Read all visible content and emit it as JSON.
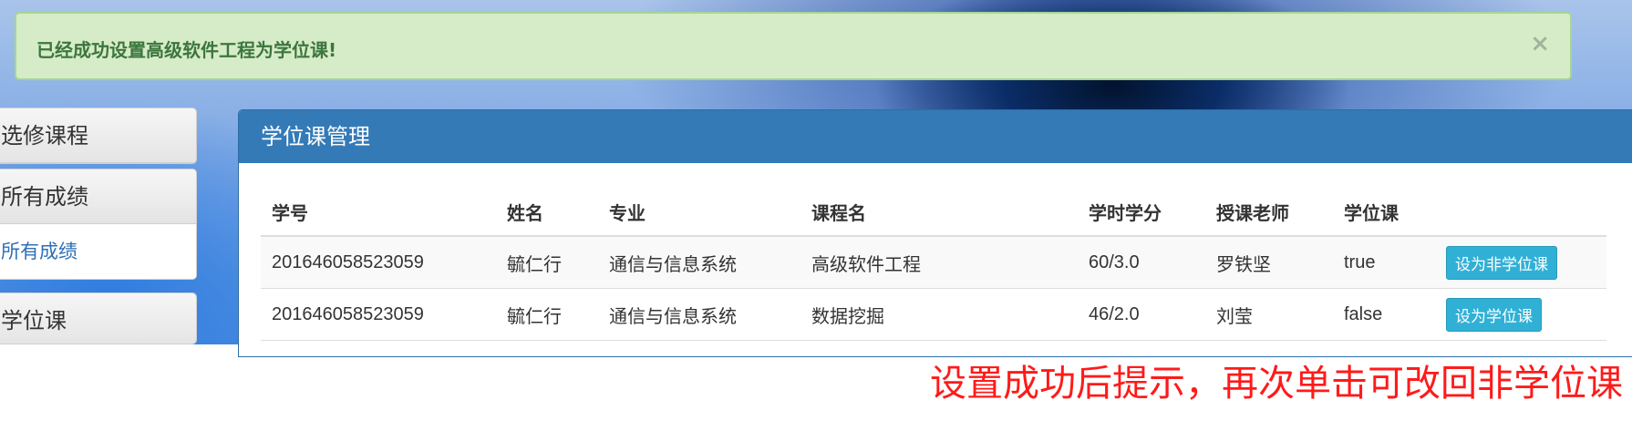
{
  "alert": {
    "message": "已经成功设置高级软件工程为学位课!",
    "close_label": "×"
  },
  "sidebar": {
    "panels": [
      {
        "heading": "选修课程"
      },
      {
        "heading": "所有成绩",
        "link": "所有成绩"
      },
      {
        "heading": "学位课"
      }
    ]
  },
  "main": {
    "title": "学位课管理",
    "columns": [
      "学号",
      "姓名",
      "专业",
      "课程名",
      "学时学分",
      "授课老师",
      "学位课",
      ""
    ],
    "rows": [
      {
        "student_id": "201646058523059",
        "name": "毓仁行",
        "major": "通信与信息系统",
        "course": "高级软件工程",
        "hours_credits": "60/3.0",
        "teacher": "罗铁坚",
        "is_degree": "true",
        "action": "设为非学位课"
      },
      {
        "student_id": "201646058523059",
        "name": "毓仁行",
        "major": "通信与信息系统",
        "course": "数据挖掘",
        "hours_credits": "46/2.0",
        "teacher": "刘莹",
        "is_degree": "false",
        "action": "设为学位课"
      }
    ]
  },
  "annotation": "设置成功后提示，再次单击可改回非学位课",
  "colors": {
    "alert_bg": "#d6ecc8",
    "alert_text": "#3c763d",
    "panel_heading": "#337ab7",
    "button": "#31b0d5",
    "annotation": "#ff1a1a"
  }
}
